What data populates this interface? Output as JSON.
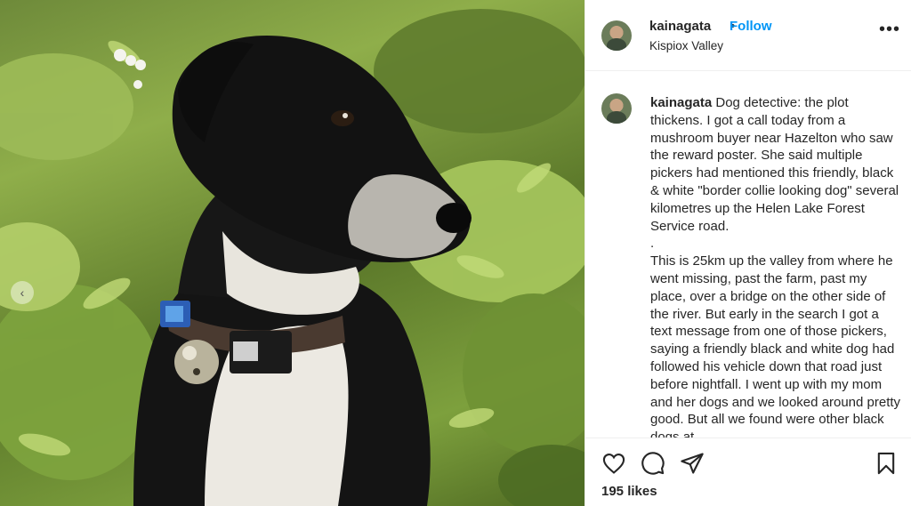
{
  "post": {
    "header": {
      "username": "kainagata",
      "separator": "•",
      "follow_label": "Follow",
      "location": "Kispiox Valley",
      "more_icon": "more-options-icon"
    },
    "caption": {
      "username": "kainagata",
      "text": " Dog detective: the plot thickens. I got a call today from a mushroom buyer near Hazelton who saw the reward poster. She said multiple pickers had mentioned this friendly, black & white \"border collie looking dog\" several kilometres up the Helen Lake Forest Service road.\n.\nThis is 25km up the valley from where he went missing, past the farm, past my place, over a bridge on the other side of the river. But early in the search I got a text message from one of those pickers, saying a friendly black and white dog had followed his vehicle down that road just before nightfall. I went up with my mom and her dogs and we looked around pretty good. But all we found were other black dogs at"
    },
    "actions": {
      "like_icon": "heart-icon",
      "comment_icon": "comment-icon",
      "share_icon": "paper-plane-icon",
      "save_icon": "bookmark-icon"
    },
    "likes_text": "195 likes",
    "photo": {
      "subject": "black-and-white-dog-photo",
      "prev_icon": "chevron-left-icon"
    },
    "colors": {
      "link_blue": "#0095f6",
      "text": "#262626",
      "border": "#efefef"
    }
  }
}
